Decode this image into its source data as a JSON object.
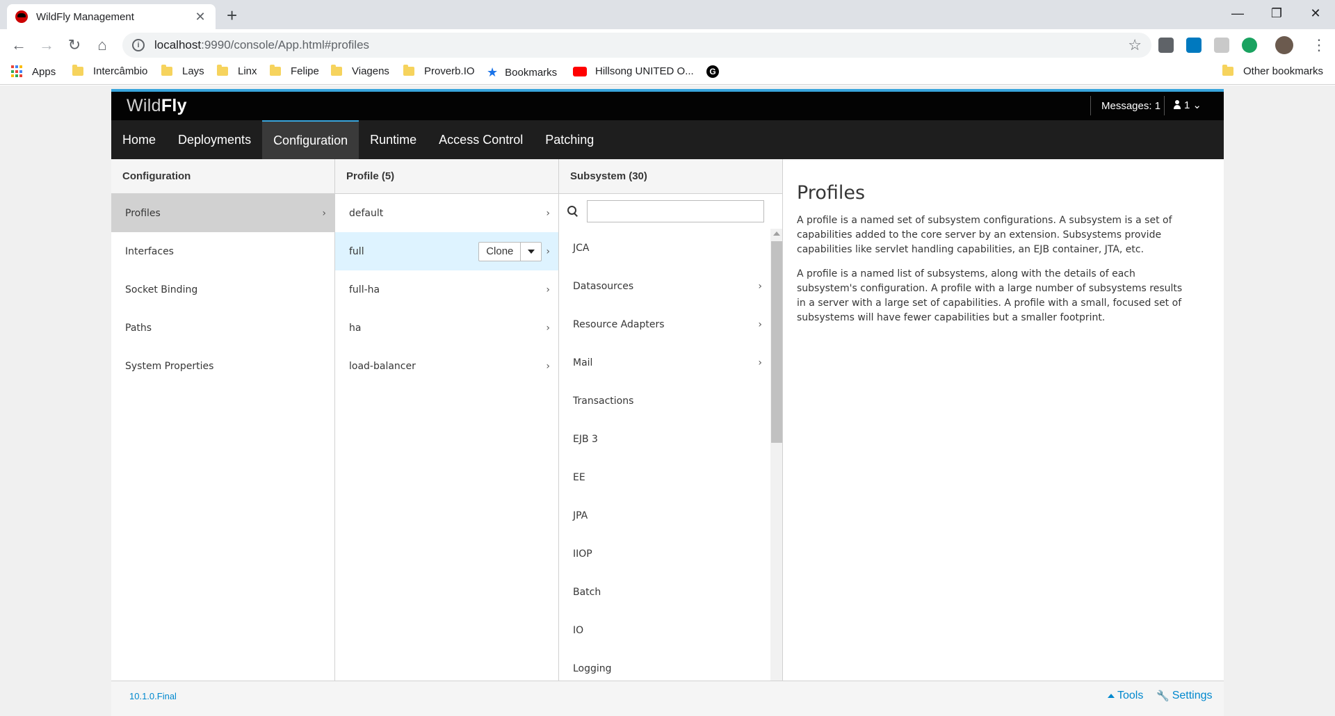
{
  "browser": {
    "tab_title": "WildFly Management",
    "tab_close": "✕",
    "new_tab": "+",
    "url_host": "localhost",
    "url_rest": ":9990/console/App.html#profiles",
    "window_controls": {
      "minimize": "—",
      "maximize": "❐",
      "close": "✕"
    },
    "bookmarks": [
      {
        "label": "Apps",
        "type": "apps"
      },
      {
        "label": "Intercâmbio",
        "type": "folder"
      },
      {
        "label": "Lays",
        "type": "folder"
      },
      {
        "label": "Linx",
        "type": "folder"
      },
      {
        "label": "Felipe",
        "type": "folder"
      },
      {
        "label": "Viagens",
        "type": "folder"
      },
      {
        "label": "Proverb.IO",
        "type": "folder"
      },
      {
        "label": "Bookmarks",
        "type": "star"
      },
      {
        "label": "Hillsong UNITED O...",
        "type": "youtube"
      },
      {
        "label": "",
        "type": "google"
      }
    ],
    "other_bookmarks": "Other bookmarks"
  },
  "app": {
    "brand_light": "Wild",
    "brand_bold": "Fly",
    "messages": "Messages: 1",
    "user_count": "1",
    "nav": [
      "Home",
      "Deployments",
      "Configuration",
      "Runtime",
      "Access Control",
      "Patching"
    ],
    "nav_active": "Configuration",
    "configuration": {
      "header": "Configuration",
      "items": [
        "Profiles",
        "Interfaces",
        "Socket Binding",
        "Paths",
        "System Properties"
      ],
      "selected": "Profiles"
    },
    "profile": {
      "header": "Profile (5)",
      "items": [
        "default",
        "full",
        "full-ha",
        "ha",
        "load-balancer"
      ],
      "selected": "full",
      "clone_label": "Clone"
    },
    "subsystem": {
      "header": "Subsystem (30)",
      "filter_value": "",
      "items": [
        {
          "label": "JCA",
          "has_children": false
        },
        {
          "label": "Datasources",
          "has_children": true
        },
        {
          "label": "Resource Adapters",
          "has_children": true
        },
        {
          "label": "Mail",
          "has_children": true
        },
        {
          "label": "Transactions",
          "has_children": false
        },
        {
          "label": "EJB 3",
          "has_children": false
        },
        {
          "label": "EE",
          "has_children": false
        },
        {
          "label": "JPA",
          "has_children": false
        },
        {
          "label": "IIOP",
          "has_children": false
        },
        {
          "label": "Batch",
          "has_children": false
        },
        {
          "label": "IO",
          "has_children": false
        },
        {
          "label": "Logging",
          "has_children": false
        }
      ]
    },
    "help": {
      "title": "Profiles",
      "paragraphs": [
        "A profile is a named set of subsystem configurations. A subsystem is a set of capabilities added to the core server by an extension. Subsystems provide capabilities like servlet handling capabilities, an EJB container, JTA, etc.",
        "A profile is a named list of subsystems, along with the details of each subsystem's configuration. A profile with a large number of subsystems results in a server with a large set of capabilities. A profile with a small, focused set of subsystems will have fewer capabilities but a smaller footprint."
      ]
    },
    "footer": {
      "version": "10.1.0.Final",
      "tools": "Tools",
      "settings": "Settings"
    },
    "colors": {
      "accent": "#39a5dc",
      "link": "#0088ce",
      "selected_row": "#def3ff"
    }
  }
}
